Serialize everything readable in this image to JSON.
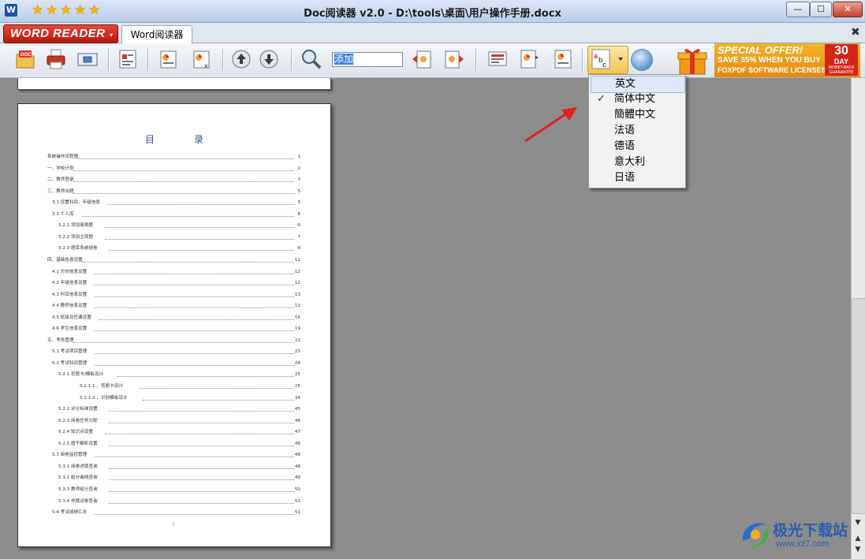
{
  "window": {
    "title": "Doc阅读器 v2.0 - D:\\tools\\桌面\\用户操作手册.docx",
    "app_icon_letter": "W",
    "rating_stars": 5,
    "buttons": {
      "minimize": "—",
      "maximize": "☐",
      "close": "✕"
    }
  },
  "tabbar": {
    "logo_text": "WORD READER",
    "logo_caret": "▾",
    "doc_tab_label": "Word阅读器",
    "close_doc": "✖"
  },
  "toolbar": {
    "search_value": "添加",
    "icons": [
      "open-doc-icon",
      "print-icon",
      "fullscreen-icon",
      "chart-page-icon",
      "prev-page-icon",
      "close-page-icon",
      "arrow-up-icon",
      "arrow-down-icon",
      "search-icon",
      "find-prev-icon",
      "find-next-icon",
      "view-mode-icon",
      "zoom-page-icon",
      "fit-page-icon",
      "translate-icon",
      "globe-icon"
    ]
  },
  "ad": {
    "line1": "SPECIAL OFFER!",
    "line2": "SAVE 35% WHEN YOU BUY",
    "line3": "FOXPDF SOFTWARE LICENSES.",
    "badge_num": "30",
    "badge_day": "DAY",
    "badge_sub": "MONEY-BACK GUARANTEE"
  },
  "language_menu": {
    "items": [
      {
        "label": "英文",
        "checked": false,
        "highlighted": true
      },
      {
        "label": "简体中文",
        "checked": true,
        "highlighted": false
      },
      {
        "label": "簡體中文",
        "checked": false,
        "highlighted": false
      },
      {
        "label": "法语",
        "checked": false,
        "highlighted": false
      },
      {
        "label": "德语",
        "checked": false,
        "highlighted": false
      },
      {
        "label": "意大利",
        "checked": false,
        "highlighted": false
      },
      {
        "label": "日语",
        "checked": false,
        "highlighted": false
      }
    ],
    "check_mark": "✓"
  },
  "document": {
    "toc_title": "目录",
    "page_number": "I",
    "toc": [
      {
        "level": 0,
        "text": "系统操作流程图",
        "page": "1"
      },
      {
        "level": 0,
        "text": "一、学校计划",
        "page": "2"
      },
      {
        "level": 0,
        "text": "二、教师登录",
        "page": "3"
      },
      {
        "level": 0,
        "text": "三、教师出题",
        "page": "5"
      },
      {
        "level": 1,
        "text": "3.1 设置科目、年级信息",
        "page": "5"
      },
      {
        "level": 1,
        "text": "3.2 个人库",
        "page": "6"
      },
      {
        "level": 2,
        "text": "3.2.1 添加客观题",
        "page": "6"
      },
      {
        "level": 2,
        "text": "3.2.2 添加主观题",
        "page": "7"
      },
      {
        "level": 2,
        "text": "3.2.3 题库系统组卷",
        "page": "8"
      },
      {
        "level": 0,
        "text": "四、基础信息设置",
        "page": "11"
      },
      {
        "level": 1,
        "text": "4.1 方向信息设置",
        "page": "12"
      },
      {
        "level": 1,
        "text": "4.2 年级信息设置",
        "page": "12"
      },
      {
        "level": 1,
        "text": "4.3 科目信息设置",
        "page": "13"
      },
      {
        "level": 1,
        "text": "4.4 教师信息设置",
        "page": "13"
      },
      {
        "level": 1,
        "text": "4.5 班级及任课设置",
        "page": "16"
      },
      {
        "level": 1,
        "text": "4.6 学生信息设置",
        "page": "19"
      },
      {
        "level": 0,
        "text": "五、考务管理",
        "page": "22"
      },
      {
        "level": 1,
        "text": "5.1 考试项目管理",
        "page": "23"
      },
      {
        "level": 1,
        "text": "5.2 考试科目管理",
        "page": "24"
      },
      {
        "level": 2,
        "text": "5.2.1 答题卡/模板设计",
        "page": "25"
      },
      {
        "level": 3,
        "text": "5.2.1.1 、答题卡设计",
        "page": "25"
      },
      {
        "level": 3,
        "text": "5.2.1.2 、识别模板设计",
        "page": "34"
      },
      {
        "level": 2,
        "text": "5.2.2 评分标准设置",
        "page": "45"
      },
      {
        "level": 2,
        "text": "5.2.3 阅卷任务分配",
        "page": "46"
      },
      {
        "level": 2,
        "text": "5.2.4 知识点设置",
        "page": "47"
      },
      {
        "level": 2,
        "text": "5.2.5 题干解析设置",
        "page": "48"
      },
      {
        "level": 1,
        "text": "5.3 阅卷监控管理",
        "page": "48"
      },
      {
        "level": 2,
        "text": "5.3.1 阅卷进度查询",
        "page": "48"
      },
      {
        "level": 2,
        "text": "5.3.2 给分曲线查询",
        "page": "49"
      },
      {
        "level": 2,
        "text": "5.3.3 教师给分查询",
        "page": "50"
      },
      {
        "level": 2,
        "text": "5.3.4 仲裁试卷查询",
        "page": "51"
      },
      {
        "level": 1,
        "text": "5.4 考试成绩汇总",
        "page": "51"
      }
    ]
  },
  "watermark": {
    "text": "极光下载站",
    "url": "www.xz7.com"
  },
  "colors": {
    "accent": "#2f5496",
    "logo_red": "#c9281a",
    "ad_orange": "#e9961a",
    "arrow_red": "#e0231b"
  }
}
